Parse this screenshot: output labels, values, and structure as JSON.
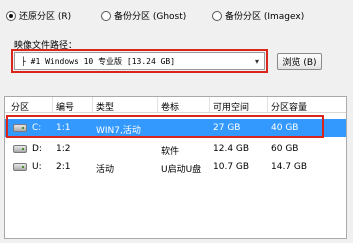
{
  "restore_options": [
    {
      "label": "还原分区 (R)",
      "selected": true
    },
    {
      "label": "备份分区 (Ghost)",
      "selected": false
    },
    {
      "label": "备份分区 (Imagex)",
      "selected": false
    }
  ],
  "image_path": {
    "label": "映像文件路径：",
    "value": "├ #1 Windows 10 专业版 [13.24 GB]",
    "browse_label": "浏览 (B)"
  },
  "table": {
    "columns": [
      "分区",
      "编号",
      "类型",
      "卷标",
      "可用空间",
      "分区容量"
    ],
    "rows": [
      {
        "drive": "C:",
        "number": "1:1",
        "type": "WIN7,活动",
        "label": "",
        "free": "27 GB",
        "capacity": "40 GB",
        "selected": true
      },
      {
        "drive": "D:",
        "number": "1:2",
        "type": "",
        "label": "软件",
        "free": "12.4 GB",
        "capacity": "60 GB",
        "selected": false
      },
      {
        "drive": "U:",
        "number": "2:1",
        "type": "活动",
        "label": "U启动U盘",
        "free": "10.7 GB",
        "capacity": "14.7 GB",
        "selected": false
      }
    ]
  },
  "colors": {
    "highlight": "#3399ff",
    "annotation_red": "#d9261c"
  }
}
